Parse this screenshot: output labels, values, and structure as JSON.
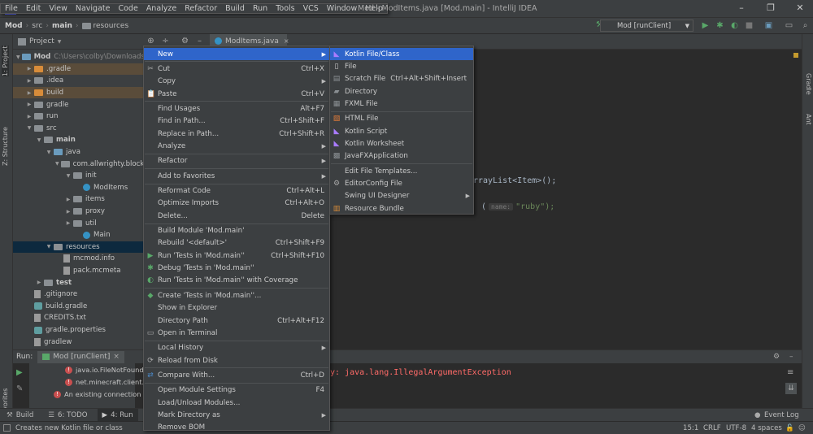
{
  "titlebar": {
    "menus": [
      "File",
      "Edit",
      "View",
      "Navigate",
      "Code",
      "Analyze",
      "Refactor",
      "Build",
      "Run",
      "Tools",
      "VCS",
      "Window",
      "Help"
    ],
    "title": "Mod - ModItems.java [Mod.main] - IntelliJ IDEA"
  },
  "navbar": {
    "crumbs": [
      "Mod",
      "src",
      "main",
      "resources"
    ],
    "run_config": "Mod [runClient]"
  },
  "leftstripe": {
    "project": "1: Project",
    "structure": "Z: Structure",
    "favorites": "2: Favorites"
  },
  "rightstripe": {
    "gradle": "Gradle",
    "ant": "Ant"
  },
  "project_panel": {
    "title": "Project"
  },
  "tree": [
    {
      "label": "Mod",
      "extra": "C:\\Users\\colby\\Downloads\\",
      "icon": "module",
      "depth": 0,
      "twisty": "down",
      "bold": true
    },
    {
      "label": ".gradle",
      "icon": "folder-orange",
      "depth": 1,
      "twisty": "right",
      "hl": "orange"
    },
    {
      "label": ".idea",
      "icon": "folder",
      "depth": 1,
      "twisty": "right"
    },
    {
      "label": "build",
      "icon": "folder-orange",
      "depth": 1,
      "twisty": "right",
      "hl": "orange"
    },
    {
      "label": "gradle",
      "icon": "folder",
      "depth": 1,
      "twisty": "right"
    },
    {
      "label": "run",
      "icon": "folder",
      "depth": 1,
      "twisty": "right"
    },
    {
      "label": "src",
      "icon": "folder",
      "depth": 1,
      "twisty": "down"
    },
    {
      "label": "main",
      "icon": "folder",
      "depth": 2,
      "twisty": "down",
      "bold": true
    },
    {
      "label": "java",
      "icon": "folder-blue",
      "depth": 3,
      "twisty": "down"
    },
    {
      "label": "com.allwrighty.block",
      "icon": "package",
      "depth": 4,
      "twisty": "down"
    },
    {
      "label": "init",
      "icon": "package",
      "depth": 5,
      "twisty": "down"
    },
    {
      "label": "ModItems",
      "icon": "class",
      "depth": 6,
      "twisty": ""
    },
    {
      "label": "items",
      "icon": "package",
      "depth": 5,
      "twisty": "right"
    },
    {
      "label": "proxy",
      "icon": "package",
      "depth": 5,
      "twisty": "right"
    },
    {
      "label": "util",
      "icon": "package",
      "depth": 5,
      "twisty": "right"
    },
    {
      "label": "Main",
      "icon": "class",
      "depth": 6,
      "twisty": ""
    },
    {
      "label": "resources",
      "icon": "folder",
      "depth": 3,
      "twisty": "down",
      "hl": "blue"
    },
    {
      "label": "mcmod.info",
      "icon": "file",
      "depth": 4,
      "twisty": ""
    },
    {
      "label": "pack.mcmeta",
      "icon": "file",
      "depth": 4,
      "twisty": ""
    },
    {
      "label": "test",
      "icon": "folder",
      "depth": 2,
      "twisty": "right",
      "bold": true
    },
    {
      "label": ".gitignore",
      "icon": "file",
      "depth": 1,
      "twisty": ""
    },
    {
      "label": "build.gradle",
      "icon": "gradle",
      "depth": 1,
      "twisty": ""
    },
    {
      "label": "CREDITS.txt",
      "icon": "file",
      "depth": 1,
      "twisty": ""
    },
    {
      "label": "gradle.properties",
      "icon": "gradle",
      "depth": 1,
      "twisty": ""
    },
    {
      "label": "gradlew",
      "icon": "file",
      "depth": 1,
      "twisty": ""
    }
  ],
  "editor": {
    "tab": "ModItems.java",
    "line1": "rrayList<Item>();",
    "line2_hint": "name:",
    "line2_value": "\"ruby\");"
  },
  "run_panel": {
    "label": "Run:",
    "config": "Mod [runClient]",
    "items": [
      "java.io.FileNotFoundE",
      "net.minecraft.client.re",
      "An existing connection w"
    ],
    "console": "y: java.lang.IllegalArgumentException"
  },
  "bottombar": {
    "build": "Build",
    "todo": "6: TODO",
    "run": "4: Run",
    "eventlog": "Event Log"
  },
  "statusbar": {
    "message": "Creates new Kotlin file or class",
    "pos": "15:1",
    "crlf": "CRLF",
    "enc": "UTF-8",
    "indent": "4 spaces"
  },
  "context_menu": [
    {
      "label": "New",
      "shortcut": "",
      "submenu": true,
      "icon": "",
      "hl": true
    },
    {
      "sep": true
    },
    {
      "label": "Cut",
      "shortcut": "Ctrl+X",
      "icon": "cut-icon"
    },
    {
      "label": "Copy",
      "shortcut": "",
      "submenu": true,
      "icon": ""
    },
    {
      "label": "Paste",
      "shortcut": "Ctrl+V",
      "icon": "paste-icon"
    },
    {
      "sep": true
    },
    {
      "label": "Find Usages",
      "shortcut": "Alt+F7",
      "icon": ""
    },
    {
      "label": "Find in Path...",
      "shortcut": "Ctrl+Shift+F",
      "icon": ""
    },
    {
      "label": "Replace in Path...",
      "shortcut": "Ctrl+Shift+R",
      "icon": ""
    },
    {
      "label": "Analyze",
      "shortcut": "",
      "submenu": true,
      "icon": ""
    },
    {
      "sep": true
    },
    {
      "label": "Refactor",
      "shortcut": "",
      "submenu": true,
      "icon": ""
    },
    {
      "sep": true
    },
    {
      "label": "Add to Favorites",
      "shortcut": "",
      "submenu": true,
      "icon": ""
    },
    {
      "sep": true
    },
    {
      "label": "Reformat Code",
      "shortcut": "Ctrl+Alt+L",
      "icon": ""
    },
    {
      "label": "Optimize Imports",
      "shortcut": "Ctrl+Alt+O",
      "icon": ""
    },
    {
      "label": "Delete...",
      "shortcut": "Delete",
      "icon": ""
    },
    {
      "sep": true
    },
    {
      "label": "Build Module 'Mod.main'",
      "shortcut": "",
      "icon": ""
    },
    {
      "label": "Rebuild '<default>'",
      "shortcut": "Ctrl+Shift+F9",
      "icon": ""
    },
    {
      "label": "Run 'Tests in 'Mod.main''",
      "shortcut": "Ctrl+Shift+F10",
      "icon": "run-icon"
    },
    {
      "label": "Debug 'Tests in 'Mod.main''",
      "shortcut": "",
      "icon": "debug-icon"
    },
    {
      "label": "Run 'Tests in 'Mod.main'' with Coverage",
      "shortcut": "",
      "icon": "coverage-icon"
    },
    {
      "sep": true
    },
    {
      "label": "Create 'Tests in 'Mod.main''...",
      "shortcut": "",
      "icon": "create-test-icon"
    },
    {
      "label": "Show in Explorer",
      "shortcut": "",
      "icon": ""
    },
    {
      "label": "Directory Path",
      "shortcut": "Ctrl+Alt+F12",
      "icon": ""
    },
    {
      "label": "Open in Terminal",
      "shortcut": "",
      "icon": "terminal-icon"
    },
    {
      "sep": true
    },
    {
      "label": "Local History",
      "shortcut": "",
      "submenu": true,
      "icon": ""
    },
    {
      "label": "Reload from Disk",
      "shortcut": "",
      "icon": "reload-icon"
    },
    {
      "sep": true
    },
    {
      "label": "Compare With...",
      "shortcut": "Ctrl+D",
      "icon": "compare-icon"
    },
    {
      "sep": true
    },
    {
      "label": "Open Module Settings",
      "shortcut": "F4",
      "icon": ""
    },
    {
      "label": "Load/Unload Modules...",
      "shortcut": "",
      "icon": ""
    },
    {
      "label": "Mark Directory as",
      "shortcut": "",
      "submenu": true,
      "icon": ""
    },
    {
      "label": "Remove BOM",
      "shortcut": "",
      "icon": ""
    }
  ],
  "new_submenu": [
    {
      "label": "Kotlin File/Class",
      "shortcut": "",
      "icon": "kotlin-icon",
      "hl": true
    },
    {
      "label": "File",
      "shortcut": "",
      "icon": "file-icon"
    },
    {
      "label": "Scratch File",
      "shortcut": "Ctrl+Alt+Shift+Insert",
      "icon": "scratch-icon"
    },
    {
      "label": "Directory",
      "shortcut": "",
      "icon": "folder-icon"
    },
    {
      "label": "FXML File",
      "shortcut": "",
      "icon": "fxml-icon"
    },
    {
      "sep": true
    },
    {
      "label": "HTML File",
      "shortcut": "",
      "icon": "html-icon"
    },
    {
      "label": "Kotlin Script",
      "shortcut": "",
      "icon": "kotlin-script-icon"
    },
    {
      "label": "Kotlin Worksheet",
      "shortcut": "",
      "icon": "kotlin-worksheet-icon"
    },
    {
      "label": "JavaFXApplication",
      "shortcut": "",
      "icon": "javafx-icon"
    },
    {
      "sep": true
    },
    {
      "label": "Edit File Templates...",
      "shortcut": "",
      "icon": ""
    },
    {
      "label": "EditorConfig File",
      "shortcut": "",
      "icon": "gear-icon"
    },
    {
      "label": "Swing UI Designer",
      "shortcut": "",
      "submenu": true,
      "icon": ""
    },
    {
      "label": "Resource Bundle",
      "shortcut": "",
      "icon": "bundle-icon"
    }
  ],
  "colors": {
    "highlight": "#2f65ca",
    "panel": "#3c3f41",
    "editor": "#2b2b2b",
    "error": "#c94f4f",
    "run_green": "#59a869"
  }
}
